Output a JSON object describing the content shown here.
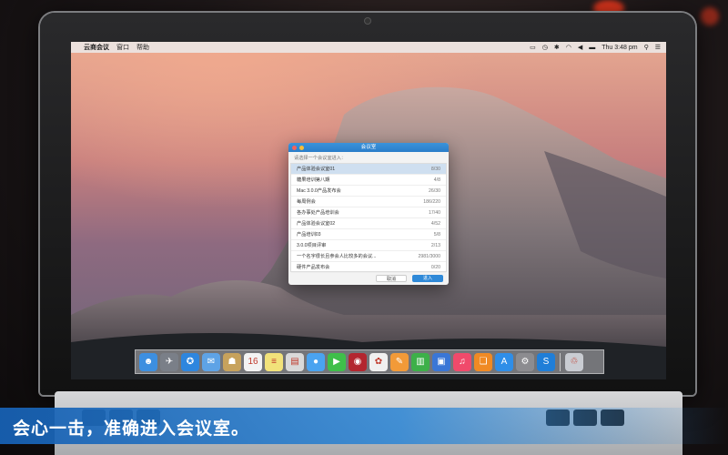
{
  "menubar": {
    "app_name": "云商会议",
    "menus": [
      "窗口",
      "帮助"
    ],
    "clock": "Thu 3:48 pm"
  },
  "dialog": {
    "title": "会议室",
    "prompt": "请选择一个会议室进入：",
    "rooms": [
      {
        "name": "产品体验会议室01",
        "count": "8/30"
      },
      {
        "name": "糖果培训第八期",
        "count": "4/8"
      },
      {
        "name": "Mac 3.0.0产品发布会",
        "count": "26/30"
      },
      {
        "name": "每周例会",
        "count": "186/220"
      },
      {
        "name": "各办事处产品培训会",
        "count": "17/40"
      },
      {
        "name": "产品体验会议室02",
        "count": "4/52"
      },
      {
        "name": "产品培训03",
        "count": "5/8"
      },
      {
        "name": "3.0.0项目评审",
        "count": "2/13"
      },
      {
        "name": "一个名字很长且参会人比较多的会议...",
        "count": "2981/3000"
      },
      {
        "name": "硬件产品发布会",
        "count": "0/20"
      }
    ],
    "selected_index": 0,
    "cancel_label": "取消",
    "enter_label": "进入"
  },
  "dock": {
    "apps": [
      {
        "icon": "finder-icon",
        "color": "#3d8fe0",
        "glyph": "☻"
      },
      {
        "icon": "launchpad-icon",
        "color": "#7a7f88",
        "glyph": "✈"
      },
      {
        "icon": "safari-icon",
        "color": "#2e86de",
        "glyph": "✪"
      },
      {
        "icon": "mail-icon",
        "color": "#5ea3e6",
        "glyph": "✉"
      },
      {
        "icon": "contacts-icon",
        "color": "#c7a25c",
        "glyph": "☗"
      },
      {
        "icon": "calendar-icon",
        "color": "#f3f3f3",
        "glyph": "16"
      },
      {
        "icon": "notes-icon",
        "color": "#f2e27a",
        "glyph": "≡"
      },
      {
        "icon": "preview-icon",
        "color": "#d9d9d9",
        "glyph": "▤"
      },
      {
        "icon": "messages-icon",
        "color": "#4aa3f0",
        "glyph": "●"
      },
      {
        "icon": "facetime-icon",
        "color": "#3fbf4a",
        "glyph": "▶"
      },
      {
        "icon": "photo-booth-icon",
        "color": "#b3262f",
        "glyph": "◉"
      },
      {
        "icon": "photos-icon",
        "color": "#f0f0f0",
        "glyph": "✿"
      },
      {
        "icon": "pages-icon",
        "color": "#f29a38",
        "glyph": "✎"
      },
      {
        "icon": "numbers-icon",
        "color": "#3db049",
        "glyph": "▥"
      },
      {
        "icon": "keynote-icon",
        "color": "#3a76d6",
        "glyph": "▣"
      },
      {
        "icon": "itunes-icon",
        "color": "#f04a6b",
        "glyph": "♫"
      },
      {
        "icon": "ibooks-icon",
        "color": "#f08a24",
        "glyph": "❏"
      },
      {
        "icon": "app-store-icon",
        "color": "#2f8ee8",
        "glyph": "A"
      },
      {
        "icon": "system-preferences-icon",
        "color": "#8c8c90",
        "glyph": "⚙"
      },
      {
        "icon": "yunshang-meeting-icon",
        "color": "#1f7ed8",
        "glyph": "S"
      },
      {
        "icon": "trash-icon",
        "color": "#c9ccd2",
        "glyph": "♲"
      }
    ]
  },
  "caption": "会心一击，准确进入会议室。"
}
